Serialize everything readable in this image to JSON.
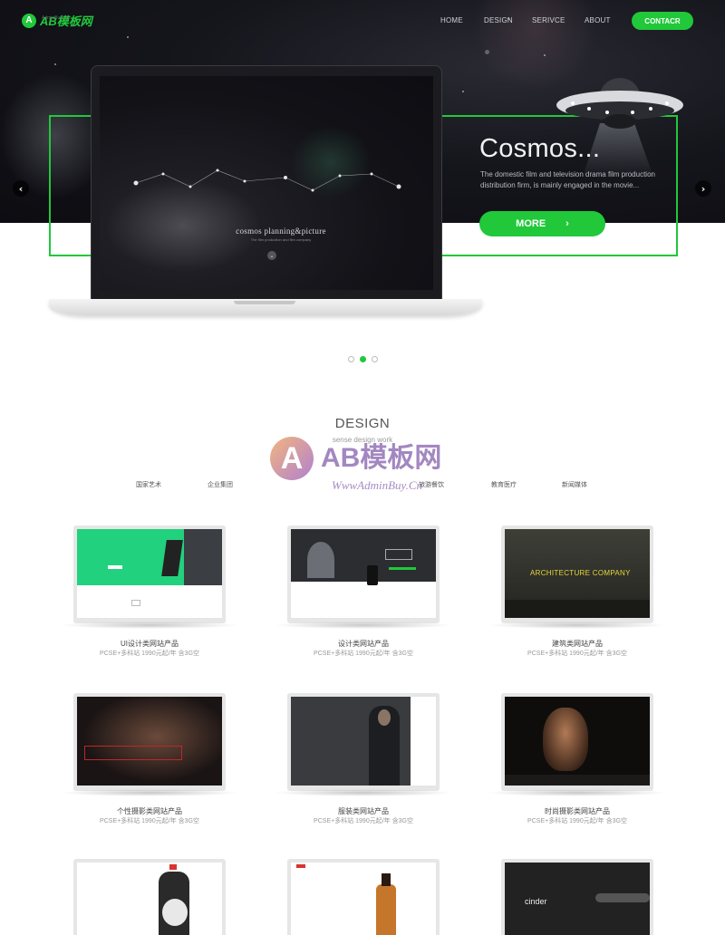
{
  "brand": {
    "logo_mark": "A",
    "logo_text": "AB模板网",
    "logo_sub": "AdminBuy.Cn",
    "accent_color": "#21c83a"
  },
  "nav": {
    "items": [
      "HOME",
      "DESIGN",
      "SERIVCE",
      "ABOUT"
    ],
    "contact": "CONTACR"
  },
  "hero": {
    "title": "Cosmos...",
    "description": "The domestic film and television drama film production distribution firm, is mainly engaged in the movie...",
    "more_label": "MORE",
    "more_icon": "chevron-right-icon",
    "prev_icon": "chevron-left-icon",
    "next_icon": "chevron-right-icon",
    "screen_title": "cosmos planning&picture",
    "screen_sub": "The film production and film company",
    "slide_count": 3,
    "active_slide": 2
  },
  "design": {
    "title": "DESIGN",
    "subtitle": "sense design work",
    "categories": [
      "国家艺术",
      "企业集团",
      "旅游餐饮",
      "教育医疗",
      "新闻媒体"
    ],
    "watermark": {
      "text": "AB模板网",
      "url": "WwwAdminBuy.Cn"
    },
    "products": [
      {
        "title": "UI设计类网站产品",
        "meta": "PCSE+多科站 1990元起/年 含3G空"
      },
      {
        "title": "设计类网站产品",
        "meta": "PCSE+多科站 1990元起/年 含3G空"
      },
      {
        "title": "建筑类网站产品",
        "meta": "PCSE+多科站 1990元起/年 含3G空",
        "screen_text": "ARCHITECTURE COMPANY"
      },
      {
        "title": "个性摄影类网站产品",
        "meta": "PCSE+多科站 1990元起/年 含3G空"
      },
      {
        "title": "服装类网站产品",
        "meta": "PCSE+多科站 1990元起/年 含3G空"
      },
      {
        "title": "时尚摄影类网站产品",
        "meta": "PCSE+多科站 1990元起/年 含3G空"
      },
      {
        "title": "",
        "meta": ""
      },
      {
        "title": "",
        "meta": ""
      },
      {
        "title": "",
        "meta": "",
        "screen_text": "cinder"
      }
    ]
  }
}
